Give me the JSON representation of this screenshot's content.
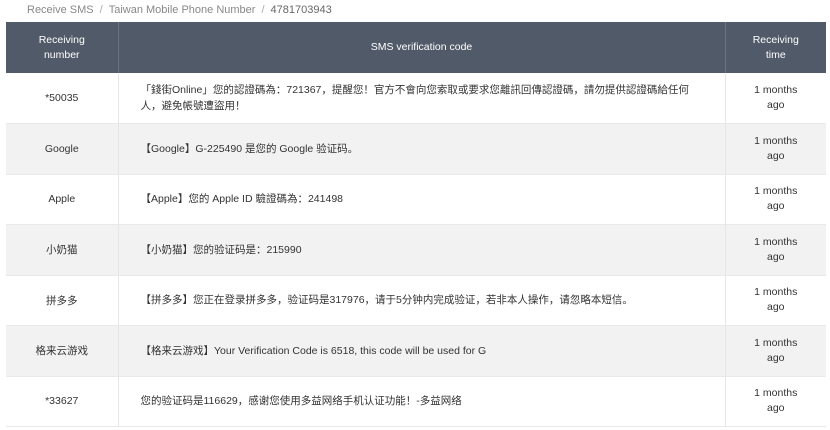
{
  "breadcrumb": {
    "home": "Receive SMS",
    "section": "Taiwan Mobile Phone Number",
    "current": "4781703943",
    "separator": "/"
  },
  "table": {
    "headers": {
      "number": "Receiving number",
      "code": "SMS verification code",
      "time": "Receiving time"
    },
    "rows": [
      {
        "number": "*50035",
        "message": "「錢街Online」您的認證碼為：721367，提醒您！官方不會向您索取或要求您離訊回傳認證碼，請勿提供認證碼給任何人，避免帳號遭盜用！",
        "time": "1 months ago"
      },
      {
        "number": "Google",
        "message": "【Google】G-225490 是您的 Google 验证码。",
        "time": "1 months ago"
      },
      {
        "number": "Apple",
        "message": "【Apple】您的 Apple ID 驗證碼為：241498",
        "time": "1 months ago"
      },
      {
        "number": "小奶猫",
        "message": "【小奶猫】您的验证码是：215990",
        "time": "1 months ago"
      },
      {
        "number": "拼多多",
        "message": "【拼多多】您正在登录拼多多，验证码是317976，请于5分钟内完成验证，若非本人操作，请忽略本短信。",
        "time": "1 months ago"
      },
      {
        "number": "格来云游戏",
        "message": "【格来云游戏】Your Verification Code is 6518, this code will be used for G",
        "time": "1 months ago"
      },
      {
        "number": "*33627",
        "message": "您的验证码是116629，感谢您使用多益网络手机认证功能！-多益网络",
        "time": "1 months ago"
      }
    ]
  }
}
